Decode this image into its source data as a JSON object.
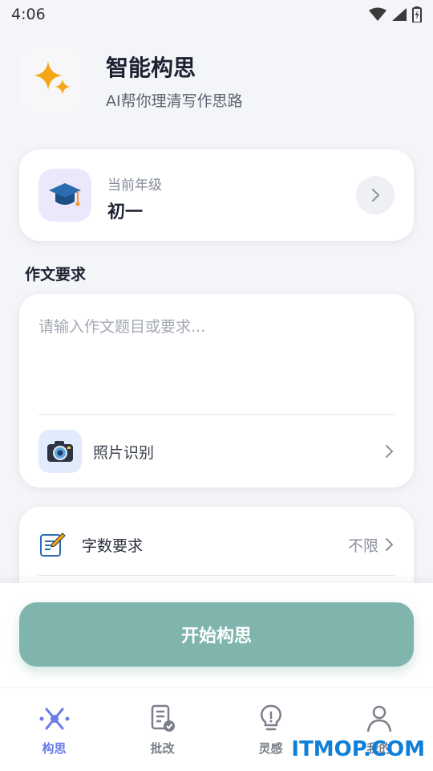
{
  "status_bar": {
    "time": "4:06"
  },
  "header": {
    "title": "智能构思",
    "subtitle": "AI帮你理清写作思路"
  },
  "grade": {
    "caption": "当前年级",
    "value": "初一"
  },
  "requirement": {
    "section_label": "作文要求",
    "placeholder": "请输入作文题目或要求...",
    "photo_label": "照片识别"
  },
  "options": {
    "word_count_label": "字数要求",
    "word_count_value": "不限"
  },
  "actions": {
    "start_label": "开始构思"
  },
  "nav": {
    "items": [
      {
        "label": "构思",
        "active": true
      },
      {
        "label": "批改"
      },
      {
        "label": "灵感"
      },
      {
        "label": "我的"
      }
    ]
  },
  "watermark": "ITMOP.COM",
  "colors": {
    "accent": "#7fb5ad",
    "nav_active": "#6c7ce8"
  }
}
